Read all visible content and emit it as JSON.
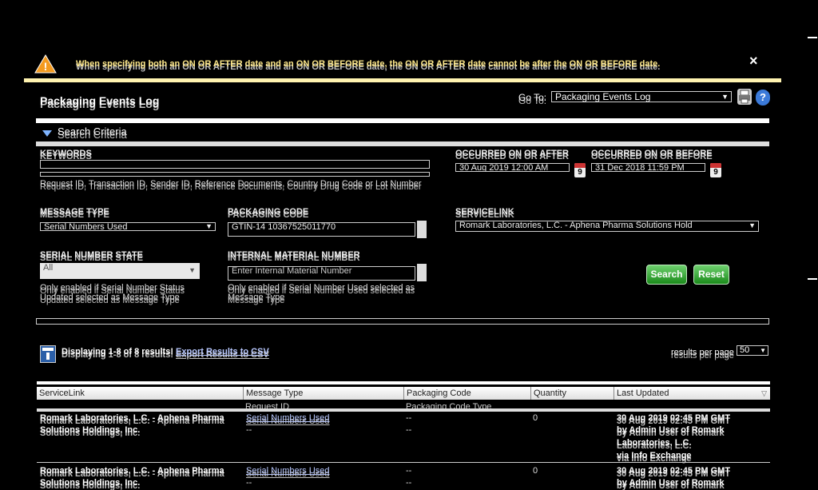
{
  "alert": {
    "message": "When specifying both an ON OR AFTER date and an ON OR BEFORE date, the ON OR AFTER date cannot be after the ON OR BEFORE date.",
    "close_icon": "×",
    "warning_icon": "!"
  },
  "header": {
    "title": "Packaging Events Log",
    "goto_label": "Go To:",
    "goto_value": "Packaging Events Log"
  },
  "search": {
    "section_title": "Search Criteria",
    "keywords_label": "KEYWORDS",
    "keywords_value": "",
    "keywords_hint": "Request ID, Transaction ID, Sender ID, Reference Documents, Country Drug Code or Lot Number",
    "after_label": "OCCURRED ON OR AFTER",
    "after_value": "30 Aug 2019 12:00 AM",
    "before_label": "OCCURRED ON OR BEFORE",
    "before_value": "31 Dec 2018 11:59 PM",
    "calendar_day": "9",
    "message_type_label": "MESSAGE TYPE",
    "message_type_value": "Serial Numbers Used",
    "packaging_code_label": "PACKAGING CODE",
    "packaging_code_value": "GTIN-14 10367525011770",
    "servicelink_label": "SERVICELINK",
    "servicelink_value": "Romark Laboratories, L.C. - Aphena Pharma Solutions Hold",
    "serial_state_label": "SERIAL NUMBER STATE",
    "serial_state_value": "All",
    "serial_state_hint": "Only enabled if Serial Number Status Updated selected as Message Type",
    "material_label": "INTERNAL MATERIAL NUMBER",
    "material_placeholder": "Enter Internal Material Number",
    "material_hint": "Only enabled if Serial Number Used selected as Message Type",
    "search_button": "Search",
    "reset_button": "Reset"
  },
  "results": {
    "summary": "Displaying 1-8 of 8 results!",
    "export_link": "Export Results to CSV",
    "per_page_label": "results per page",
    "per_page_value": "50"
  },
  "table": {
    "columns": [
      "ServiceLink",
      "Message Type",
      "Packaging Code",
      "Quantity",
      "Last Updated"
    ],
    "subcolumns": [
      "Request ID",
      "Packaging Code Type"
    ],
    "rows": [
      {
        "servicelink_line1": "Romark Laboratories, L.C. - Aphena Pharma",
        "servicelink_line2": "Solutions Holdings, Inc.",
        "message_type": "Serial Numbers Used",
        "request_id": "--",
        "packaging_code": "--",
        "packaging_code_type": "--",
        "quantity": "0",
        "updated_line1": "30 Aug 2019 02:45 PM GMT",
        "updated_line2": "by Admin User of Romark",
        "updated_line3": "Laboratories, L.C.",
        "updated_line4": "via Info Exchange"
      },
      {
        "servicelink_line1": "Romark Laboratories, L.C. - Aphena Pharma",
        "servicelink_line2": "Solutions Holdings, Inc.",
        "message_type": "Serial Numbers Used",
        "request_id": "--",
        "packaging_code": "--",
        "packaging_code_type": "--",
        "quantity": "0",
        "updated_line1": "30 Aug 2019 02:45 PM GMT",
        "updated_line2": "by Admin User of Romark",
        "updated_line3": "",
        "updated_line4": ""
      }
    ]
  }
}
